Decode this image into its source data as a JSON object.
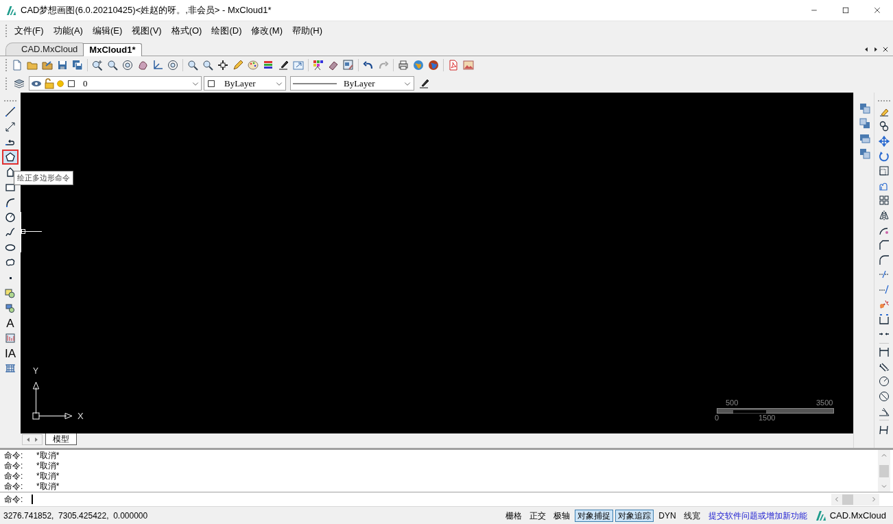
{
  "window": {
    "title": "CAD梦想画图(6.0.20210425)<姓赵的呀。,非会员> - MxCloud1*"
  },
  "menu": [
    "文件(F)",
    "功能(A)",
    "编辑(E)",
    "视图(V)",
    "格式(O)",
    "绘图(D)",
    "修改(M)",
    "帮助(H)"
  ],
  "document_tabs": [
    {
      "label": "CAD.MxCloud",
      "selected": false
    },
    {
      "label": "MxCloud1*",
      "selected": true
    }
  ],
  "properties_bar": {
    "layer": "0",
    "color_setting": "ByLayer",
    "linetype": "ByLayer"
  },
  "draw_toolbar": {
    "tools": [
      {
        "selected": false
      },
      {
        "selected": false
      },
      {
        "selected": false
      },
      {
        "selected": true
      },
      {
        "selected": false
      },
      {
        "selected": false
      },
      {
        "selected": false
      },
      {
        "selected": false
      },
      {
        "selected": false
      },
      {
        "selected": false
      },
      {
        "selected": false
      },
      {
        "selected": false
      },
      {
        "selected": false
      },
      {
        "selected": false
      },
      {
        "selected": false,
        "label": "A"
      },
      {
        "selected": false
      },
      {
        "selected": false,
        "label": "IA"
      },
      {
        "selected": false
      }
    ]
  },
  "tooltip": "绘正多边形命令",
  "canvas": {
    "axis_labels": [
      "Y",
      "X"
    ],
    "scale_bar": {
      "top_labels": [
        "500",
        "3500"
      ],
      "bottom_labels": [
        "0",
        "1500"
      ]
    }
  },
  "layout_tabs": [
    {
      "label": "模型",
      "selected": true
    }
  ],
  "command_history": [
    {
      "prompt": "命令:",
      "text": "*取消*"
    },
    {
      "prompt": "命令:",
      "text": "*取消*"
    },
    {
      "prompt": "命令:",
      "text": "*取消*"
    },
    {
      "prompt": "命令:",
      "text": "*取消*"
    }
  ],
  "command_line": {
    "prompt": "命令:"
  },
  "status_bar": {
    "coordinates": "3276.741852,  7305.425422,  0.000000",
    "toggles": [
      {
        "label": "栅格",
        "on": false
      },
      {
        "label": "正交",
        "on": false
      },
      {
        "label": "极轴",
        "on": false
      },
      {
        "label": "对象捕捉",
        "on": true
      },
      {
        "label": "对象追踪",
        "on": true
      },
      {
        "label": "DYN",
        "on": false
      },
      {
        "label": "线宽",
        "on": false
      }
    ],
    "feedback_link": "提交软件问题或增加新功能",
    "brand": "CAD.MxCloud"
  }
}
